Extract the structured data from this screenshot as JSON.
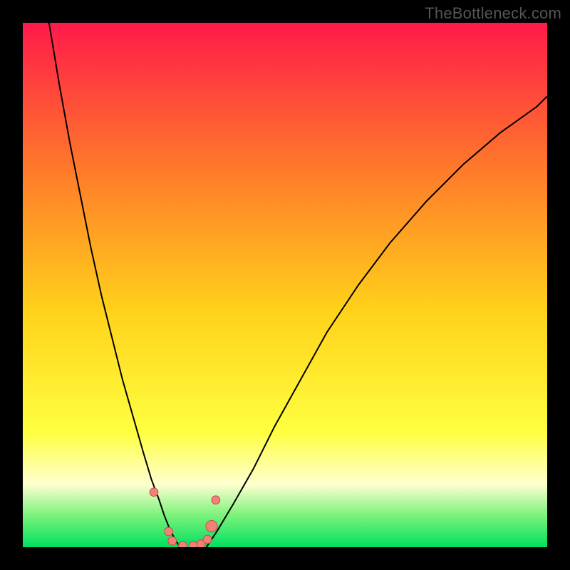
{
  "branding": "TheBottleneck.com",
  "colors": {
    "frame": "#000000",
    "grad_top": "#ff1a4a",
    "grad_mid1": "#ff7a2a",
    "grad_mid2": "#ffd21a",
    "grad_yellow": "#ffff40",
    "grad_pale": "#ffffd0",
    "grad_green_light": "#7af27a",
    "grad_green": "#00e060",
    "curve": "#000000",
    "marker_fill": "#f08078",
    "marker_stroke": "#c05048"
  },
  "chart_data": {
    "type": "line",
    "title": "",
    "xlabel": "",
    "ylabel": "",
    "xlim": [
      0,
      100
    ],
    "ylim": [
      0,
      100
    ],
    "series": [
      {
        "name": "left-curve",
        "x": [
          5,
          7,
          9,
          11,
          13,
          15,
          17,
          19,
          21,
          23,
          24.5,
          26,
          27,
          28,
          29,
          30
        ],
        "y": [
          100,
          88,
          77,
          67,
          57,
          48,
          40,
          32,
          25,
          18,
          13,
          9,
          6,
          3.5,
          1.5,
          0
        ]
      },
      {
        "name": "right-curve",
        "x": [
          35,
          37,
          40,
          44,
          48,
          53,
          58,
          64,
          70,
          77,
          84,
          91,
          98,
          100
        ],
        "y": [
          0,
          3,
          8,
          15,
          23,
          32,
          41,
          50,
          58,
          66,
          73,
          79,
          84,
          86
        ]
      }
    ],
    "markers": [
      {
        "x": 25.0,
        "y": 10.5,
        "r": 1.6
      },
      {
        "x": 27.8,
        "y": 3.0,
        "r": 1.6
      },
      {
        "x": 28.5,
        "y": 1.2,
        "r": 1.6
      },
      {
        "x": 30.5,
        "y": 0.3,
        "r": 1.6
      },
      {
        "x": 32.5,
        "y": 0.3,
        "r": 1.6
      },
      {
        "x": 34.0,
        "y": 0.6,
        "r": 1.6
      },
      {
        "x": 35.2,
        "y": 1.5,
        "r": 1.6
      },
      {
        "x": 36.0,
        "y": 4.0,
        "r": 2.2
      },
      {
        "x": 36.8,
        "y": 9.0,
        "r": 1.6
      }
    ]
  }
}
